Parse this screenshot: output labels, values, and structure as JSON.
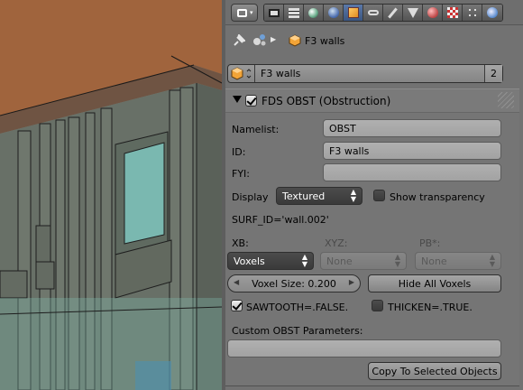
{
  "colors": {
    "accent_tab": "#4a6a9a",
    "panel_bg": "#727272",
    "roof": "#a0643d",
    "wall": "#6a7169",
    "glass": "#7ab8b0"
  },
  "header": {
    "editor_type_icon": "properties-editor-icon",
    "tabs": [
      {
        "icon": "render-icon",
        "active": false
      },
      {
        "icon": "render-layers-icon",
        "active": false
      },
      {
        "icon": "scene-icon",
        "active": false
      },
      {
        "icon": "world-icon",
        "active": false
      },
      {
        "icon": "object-icon",
        "active": true
      },
      {
        "icon": "constraints-icon",
        "active": false
      },
      {
        "icon": "modifiers-icon",
        "active": false
      },
      {
        "icon": "data-icon",
        "active": false
      },
      {
        "icon": "material-icon",
        "active": false
      },
      {
        "icon": "texture-icon",
        "active": false
      },
      {
        "icon": "particles-icon",
        "active": false
      },
      {
        "icon": "physics-icon",
        "active": false
      }
    ]
  },
  "breadcrumb": {
    "object_name": "F3 walls"
  },
  "id_block": {
    "name": "F3 walls",
    "users": "2"
  },
  "obst_panel": {
    "title": "FDS OBST (Obstruction)",
    "namelist_label": "Namelist:",
    "namelist_value": "OBST",
    "id_label": "ID:",
    "id_value": "F3 walls",
    "fyi_label": "FYI:",
    "fyi_value": "",
    "display_label": "Display",
    "display_value": "Textured",
    "show_transparency_label": "Show transparency",
    "show_transparency_checked": false,
    "surf_id_text": "SURF_ID='wall.002'",
    "xb_label": "XB:",
    "xyz_label": "XYZ:",
    "pb_label": "PB*:",
    "xb_value": "Voxels",
    "xyz_value": "None",
    "pb_value": "None",
    "voxel_size_label": "Voxel Size: 0.200",
    "hide_voxels_label": "Hide All Voxels",
    "sawtooth_label": "SAWTOOTH=.FALSE.",
    "sawtooth_checked": true,
    "thicken_label": "THICKEN=.TRUE.",
    "thicken_checked": false,
    "custom_params_label": "Custom OBST Parameters:",
    "custom_params_value": "",
    "copy_button_label": "Copy To Selected Objects"
  }
}
